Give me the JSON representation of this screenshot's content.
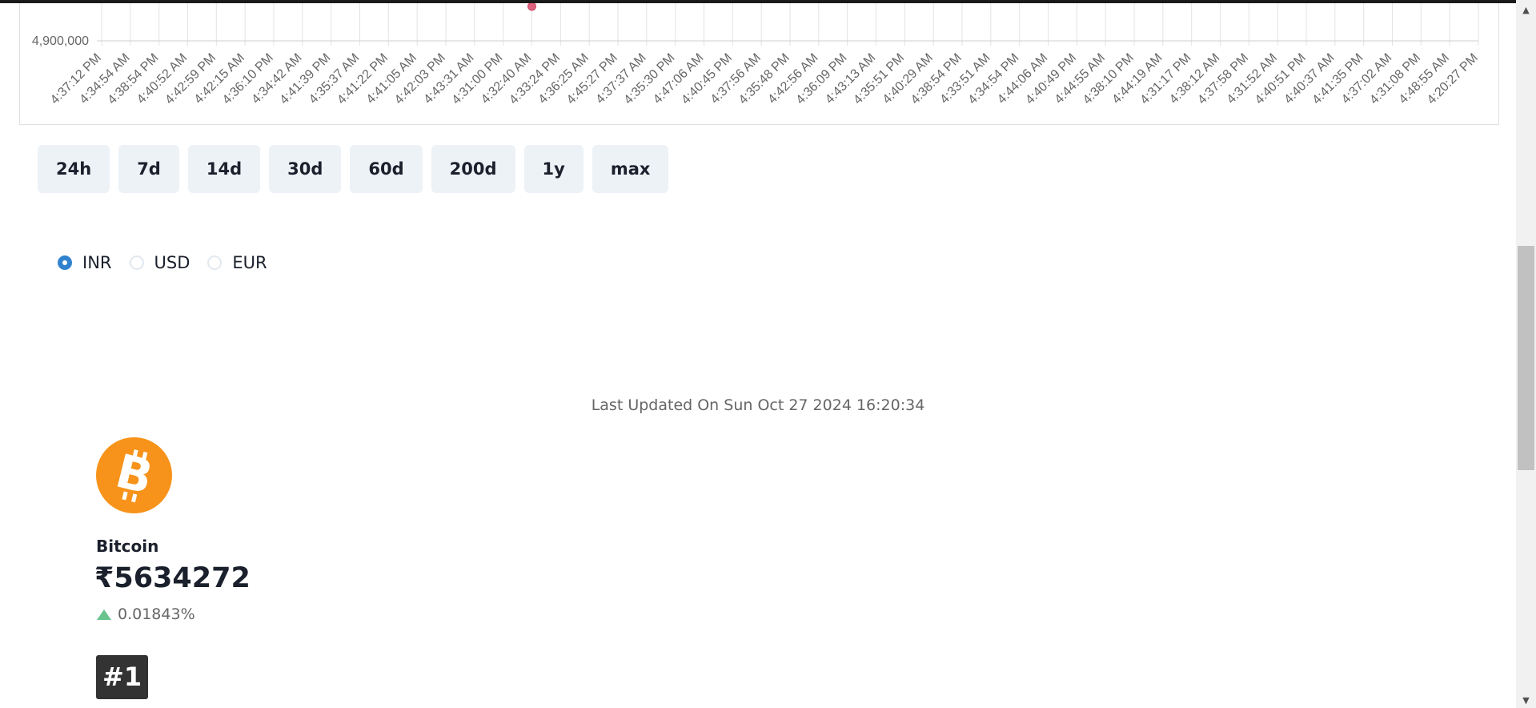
{
  "chart_data": {
    "type": "line",
    "y_tick_labels": [
      "4,900,000"
    ],
    "x_tick_labels": [
      "4:37:12 PM",
      "4:34:54 AM",
      "4:38:54 PM",
      "4:40:52 AM",
      "4:42:59 PM",
      "4:42:15 AM",
      "4:36:10 PM",
      "4:34:42 AM",
      "4:41:39 PM",
      "4:35:37 AM",
      "4:41:22 PM",
      "4:41:05 AM",
      "4:42:03 PM",
      "4:43:31 AM",
      "4:31:00 PM",
      "4:32:40 AM",
      "4:33:24 PM",
      "4:36:25 AM",
      "4:45:27 PM",
      "4:37:37 AM",
      "4:35:30 PM",
      "4:47:06 AM",
      "4:40:45 PM",
      "4:37:56 AM",
      "4:35:48 PM",
      "4:42:56 AM",
      "4:36:09 PM",
      "4:43:13 AM",
      "4:35:51 PM",
      "4:40:29 AM",
      "4:38:54 PM",
      "4:33:51 AM",
      "4:34:54 PM",
      "4:44:06 AM",
      "4:40:49 PM",
      "4:44:55 AM",
      "4:38:10 PM",
      "4:44:19 AM",
      "4:31:17 PM",
      "4:38:12 AM",
      "4:37:58 PM",
      "4:31:52 AM",
      "4:40:51 PM",
      "4:40:37 AM",
      "4:41:35 PM",
      "4:37:02 AM",
      "4:31:08 PM",
      "4:48:55 AM",
      "4:20:27 PM"
    ],
    "visible_point": {
      "x": "4:32:40 AM"
    },
    "point_color": "#e0617e",
    "grid": true
  },
  "range_buttons": [
    "24h",
    "7d",
    "14d",
    "30d",
    "60d",
    "200d",
    "1y",
    "max"
  ],
  "currency": {
    "options": [
      "INR",
      "USD",
      "EUR"
    ],
    "selected": "INR"
  },
  "last_updated": "Last Updated On Sun Oct 27 2024 16:20:34",
  "coin": {
    "icon": "bitcoin-icon",
    "logo_color": "#f7931a",
    "name": "Bitcoin",
    "price": "₹5634272",
    "change_percent": "0.01843%",
    "change_direction": "up",
    "change_color": "#68c38f",
    "rank": "#1"
  }
}
